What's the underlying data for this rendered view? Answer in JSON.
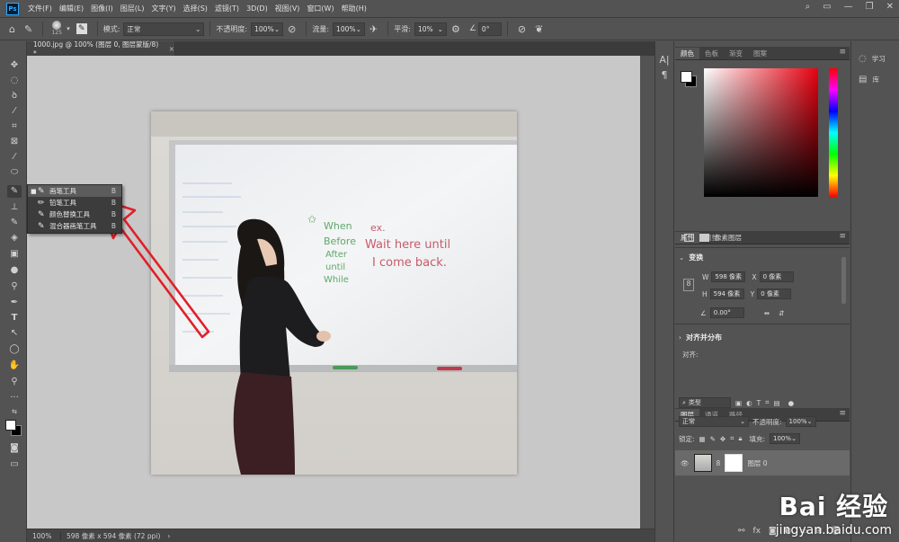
{
  "menubar": {
    "logo": "Ps",
    "items": [
      "文件(F)",
      "编辑(E)",
      "图像(I)",
      "图层(L)",
      "文字(Y)",
      "选择(S)",
      "滤镜(T)",
      "3D(D)",
      "视图(V)",
      "窗口(W)",
      "帮助(H)"
    ]
  },
  "options": {
    "brush_size": "125",
    "mode_label": "模式:",
    "mode_value": "正常",
    "opacity_label": "不透明度:",
    "opacity_value": "100%",
    "flow_label": "流量:",
    "flow_value": "100%",
    "smooth_label": "平滑:",
    "smooth_value": "10%",
    "angle_value": "0°"
  },
  "document": {
    "tab_title": "1000.jpg @ 100% (图层 0, 图层蒙版/8) *",
    "close": "×",
    "zoom": "100%",
    "status_info": "598 像素 x 594 像素 (72 ppi)",
    "status_arrow": "›"
  },
  "flyout": {
    "items": [
      {
        "label": "画笔工具",
        "key": "B"
      },
      {
        "label": "铅笔工具",
        "key": "B"
      },
      {
        "label": "颜色替换工具",
        "key": "B"
      },
      {
        "label": "混合器画笔工具",
        "key": "B"
      }
    ]
  },
  "whiteboard": {
    "green_words": [
      "When",
      "Before",
      "After",
      "until",
      "While"
    ],
    "red_lines": [
      "ex.",
      "Wait here until",
      "I come back."
    ]
  },
  "color_panel": {
    "tabs": [
      "颜色",
      "色板",
      "渐变",
      "图案"
    ]
  },
  "properties": {
    "tabs": [
      "属性",
      "调整"
    ],
    "layer_type": "像素图层",
    "transform_title": "变换",
    "w_label": "W",
    "w_value": "598 像素",
    "h_label": "H",
    "h_value": "594 像素",
    "x_label": "X",
    "x_value": "0 像素",
    "y_label": "Y",
    "y_value": "0 像素",
    "angle_value": "0.00°",
    "align_title": "对齐并分布",
    "align_label": "对齐:"
  },
  "layers": {
    "tabs": [
      "图层",
      "通道",
      "路径"
    ],
    "filter_label": "类型",
    "blend_mode": "正常",
    "opacity_label": "不透明度:",
    "opacity_value": "100%",
    "lock_label": "锁定:",
    "fill_label": "填充:",
    "fill_value": "100%",
    "layer_name": "图层 0"
  },
  "right_panels": {
    "learn": "学习",
    "library": "库"
  },
  "watermark": {
    "logo": "Bai 经验",
    "url": "jingyan.baidu.com"
  },
  "colors": {
    "app_bg": "#535353",
    "panel_dark": "#3c3c3c",
    "canvas_bg": "#c8c8c8",
    "arrow": "#e0202a",
    "marker_green": "#5ea86a",
    "marker_red": "#c85a6a"
  }
}
